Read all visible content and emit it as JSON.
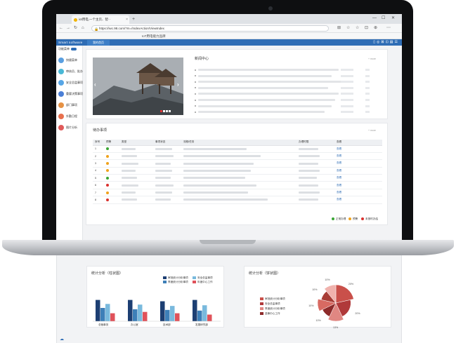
{
  "browser": {
    "tab_title": "iot用电,一个主页、智··",
    "tab_close": "×",
    "new_tab": "+",
    "url": "https://iwc.98.com/?m=/IndexAction/ViewIndex",
    "favorites_item": "IoT用电能力品牌",
    "window_controls": [
      "—",
      "☐",
      "✕"
    ],
    "nav": [
      "←",
      "→",
      "↻",
      "⌂"
    ],
    "tools": [
      "⊞",
      "☆",
      "☆",
      "⊡",
      "⊕",
      "⋯"
    ]
  },
  "app": {
    "logo": "Smart software",
    "home_tab": "我的首页",
    "header_icons": [
      "▯",
      "◎",
      "⊠",
      "⊡",
      "▤",
      "☰"
    ]
  },
  "sidebar": {
    "toggle_label": "功能菜单",
    "items": [
      {
        "label": "快捷菜单",
        "color": "#5a9fe0"
      },
      {
        "label": "审核员、批办",
        "color": "#49b8d6"
      },
      {
        "label": "安全总监事项",
        "color": "#57a6e6"
      },
      {
        "label": "重要决策事项",
        "color": "#4b7fd6"
      },
      {
        "label": "部门事项",
        "color": "#e69245"
      },
      {
        "label": "外勤日程",
        "color": "#e8704e"
      },
      {
        "label": "图片分析",
        "color": "#e05a5a"
      }
    ]
  },
  "news": {
    "title": "新闻中心",
    "more": "+ more",
    "rows": 8
  },
  "todo": {
    "title": "待办事项",
    "more": "+ more",
    "columns": [
      "序号",
      "预警",
      "类型",
      "事项状态",
      "流程/任务",
      "办理时限",
      "查看"
    ],
    "rows": [
      {
        "no": "1",
        "status": "green",
        "view": "查看"
      },
      {
        "no": "2",
        "status": "orange",
        "view": "查看"
      },
      {
        "no": "3",
        "status": "orange",
        "view": "查看"
      },
      {
        "no": "4",
        "status": "orange",
        "view": "查看"
      },
      {
        "no": "5",
        "status": "green",
        "view": "查看"
      },
      {
        "no": "6",
        "status": "red",
        "view": "查看"
      },
      {
        "no": "7",
        "status": "orange",
        "view": "查看"
      },
      {
        "no": "8",
        "status": "red",
        "view": "查看"
      }
    ],
    "legend": [
      {
        "label": "正常办理",
        "color": "green"
      },
      {
        "label": "预警",
        "color": "orange"
      },
      {
        "label": "未按时办结",
        "color": "red"
      }
    ]
  },
  "colors": {
    "green": "#3aa635",
    "orange": "#f0a21b",
    "red": "#d9302e"
  },
  "bar_panel": {
    "title": "统计分析（柱状图）",
    "legend": [
      "审批统计分析事项",
      "安全总监事项",
      "季度统计分析事项",
      "年度中心工作"
    ],
    "categories": [
      "总裁事务",
      "办公室",
      "技术部",
      "发展研究部"
    ]
  },
  "pie_panel": {
    "title": "统计分析（饼状图）",
    "legend": [
      "审批统计分析事项",
      "安全总监事项",
      "季度统计分析事项",
      "滋事中心工作"
    ],
    "labels": [
      "20%",
      "20%",
      "13%",
      "10%",
      "10%",
      "10%",
      "10%"
    ]
  },
  "chart_data": [
    {
      "type": "bar",
      "title": "统计分析（柱状图）",
      "categories": [
        "总裁事务",
        "办公室",
        "技术部",
        "发展研究部"
      ],
      "series": [
        {
          "name": "审批统计分析事项",
          "values": [
            32,
            32,
            30,
            32
          ]
        },
        {
          "name": "季度统计分析事项",
          "values": [
            20,
            18,
            17,
            16
          ]
        },
        {
          "name": "安全总监事项",
          "values": [
            26,
            25,
            23,
            24
          ]
        },
        {
          "name": "年度中心工作",
          "values": [
            12,
            14,
            12,
            10
          ]
        }
      ],
      "colors": [
        "#1d3f73",
        "#3d7fb8",
        "#79b9dd",
        "#e0525a"
      ],
      "ylim": [
        0,
        40
      ]
    },
    {
      "type": "pie",
      "title": "统计分析（饼状图）",
      "labels": [
        "20%",
        "20%",
        "13%",
        "10%",
        "10%",
        "10%",
        "10%"
      ],
      "values": [
        20,
        20,
        13,
        10,
        10,
        10,
        10
      ],
      "colors": [
        "#c9504a",
        "#b0393a",
        "#e08782",
        "#8e2b2b",
        "#d86a62",
        "#a83d36",
        "#f0b2ad"
      ]
    }
  ]
}
